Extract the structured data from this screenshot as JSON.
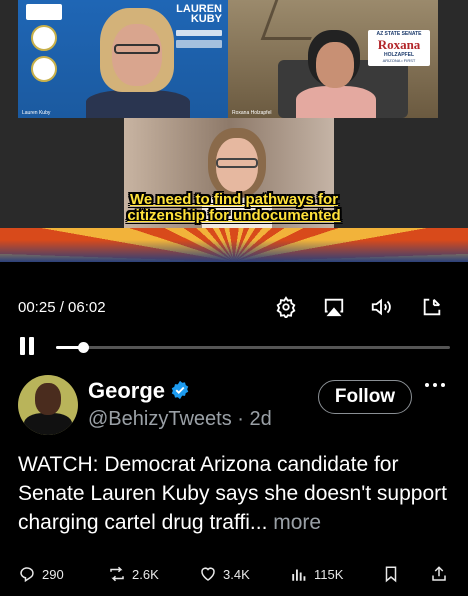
{
  "video": {
    "caption_line1": "We need to find pathways for",
    "caption_line2": "citizenship for undocumented",
    "tiles": {
      "left_name": "Lauren Kuby",
      "left_brand_line1": "LAUREN",
      "left_brand_line2": "KUBY",
      "right_name": "Roxana Holzapfel",
      "right_sign_top": "AZ STATE SENATE",
      "right_sign_main": "Roxana",
      "right_sign_sub": "HOLZAPFEL",
      "right_sign_small": "ARIZONA • FIRST"
    }
  },
  "player": {
    "time_label": "00:25 / 06:02",
    "progress_fraction": 0.069,
    "icons": [
      "gear-icon",
      "airplay-icon",
      "volume-icon",
      "minimize-icon"
    ]
  },
  "tweet": {
    "display_name": "George",
    "handle_line": "@BehizyTweets · 2d",
    "follow_label": "Follow",
    "text": "WATCH: Democrat Arizona candidate for Senate Lauren Kuby says she doesn't support charging cartel drug traffi... ",
    "more_label": "more",
    "actions": {
      "replies": "290",
      "reposts": "2.6K",
      "likes": "3.4K",
      "views": "115K"
    }
  },
  "colors": {
    "caption": "#ffe23a",
    "verified": "#1d9bf0",
    "muted": "#9aa0a6",
    "background": "#000000"
  }
}
